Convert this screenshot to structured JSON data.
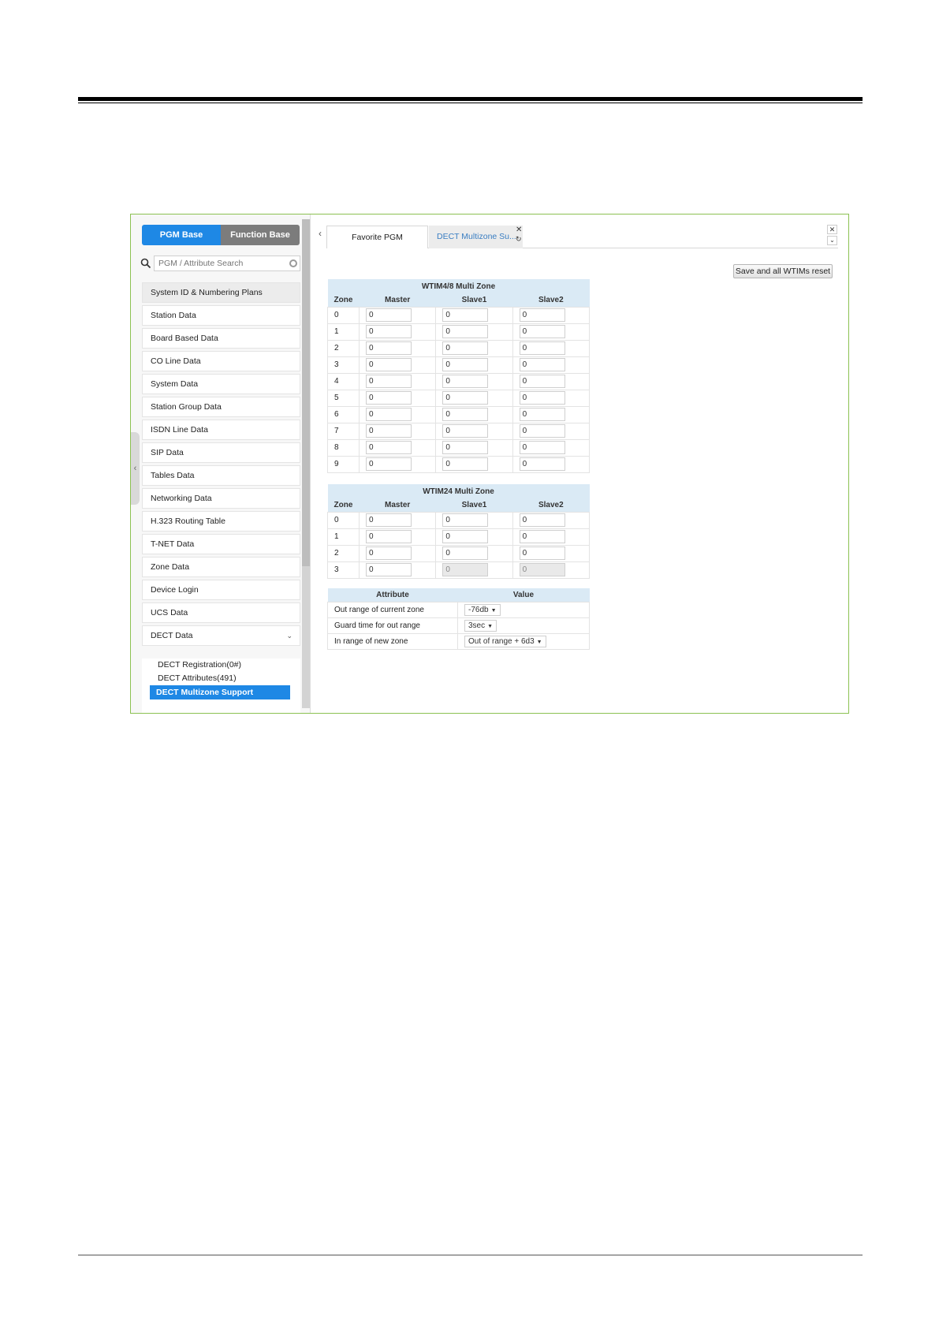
{
  "sidebar": {
    "base_tabs": {
      "pgm": "PGM Base",
      "function": "Function Base"
    },
    "search_placeholder": "PGM / Attribute Search",
    "items": [
      "System ID & Numbering Plans",
      "Station Data",
      "Board Based Data",
      "CO Line Data",
      "System Data",
      "Station Group Data",
      "ISDN Line Data",
      "SIP Data",
      "Tables Data",
      "Networking Data",
      "H.323 Routing Table",
      "T-NET Data",
      "Zone Data",
      "Device Login",
      "UCS Data",
      "DECT Data"
    ],
    "subitems": [
      "DECT Registration(0#)",
      "DECT Attributes(491)",
      "DECT Multizone Support"
    ]
  },
  "tabs": {
    "favorite": "Favorite PGM",
    "dect": "DECT Multizone Su..."
  },
  "reset_button": "Save and all WTIMs reset",
  "table1": {
    "title": "WTIM4/8 Multi Zone",
    "headers": [
      "Zone",
      "Master",
      "Slave1",
      "Slave2"
    ],
    "rows": [
      {
        "zone": "0",
        "master": "0",
        "slave1": "0",
        "slave2": "0"
      },
      {
        "zone": "1",
        "master": "0",
        "slave1": "0",
        "slave2": "0"
      },
      {
        "zone": "2",
        "master": "0",
        "slave1": "0",
        "slave2": "0"
      },
      {
        "zone": "3",
        "master": "0",
        "slave1": "0",
        "slave2": "0"
      },
      {
        "zone": "4",
        "master": "0",
        "slave1": "0",
        "slave2": "0"
      },
      {
        "zone": "5",
        "master": "0",
        "slave1": "0",
        "slave2": "0"
      },
      {
        "zone": "6",
        "master": "0",
        "slave1": "0",
        "slave2": "0"
      },
      {
        "zone": "7",
        "master": "0",
        "slave1": "0",
        "slave2": "0"
      },
      {
        "zone": "8",
        "master": "0",
        "slave1": "0",
        "slave2": "0"
      },
      {
        "zone": "9",
        "master": "0",
        "slave1": "0",
        "slave2": "0"
      }
    ]
  },
  "table2": {
    "title": "WTIM24 Multi Zone",
    "headers": [
      "Zone",
      "Master",
      "Slave1",
      "Slave2"
    ],
    "rows": [
      {
        "zone": "0",
        "master": "0",
        "slave1": "0",
        "slave2": "0"
      },
      {
        "zone": "1",
        "master": "0",
        "slave1": "0",
        "slave2": "0"
      },
      {
        "zone": "2",
        "master": "0",
        "slave1": "0",
        "slave2": "0"
      },
      {
        "zone": "3",
        "master": "0",
        "slave1": "0",
        "slave2": "0"
      }
    ]
  },
  "attributes": {
    "headers": [
      "Attribute",
      "Value"
    ],
    "rows": [
      {
        "name": "Out range of current zone",
        "value": "-76db"
      },
      {
        "name": "Guard time for out range",
        "value": "3sec"
      },
      {
        "name": "In range of new zone",
        "value": "Out of range + 6d3"
      }
    ]
  }
}
